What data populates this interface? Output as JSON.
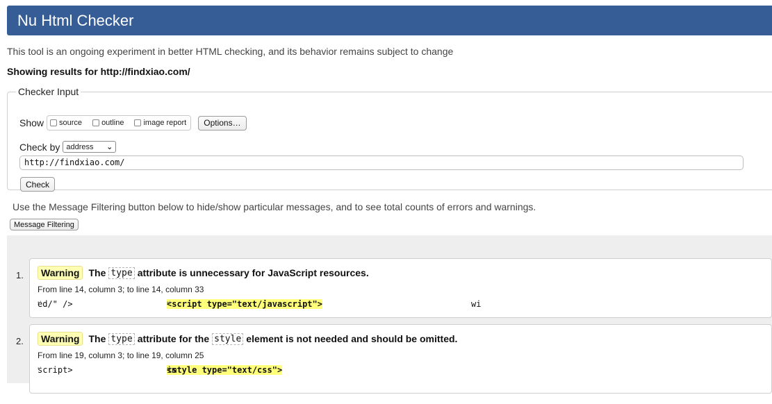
{
  "header": {
    "title": "Nu Html Checker"
  },
  "intro": "This tool is an ongoing experiment in better HTML checking, and its behavior remains subject to change",
  "showing": "Showing results for http://findxiao.com/",
  "checker": {
    "legend": "Checker Input",
    "show_label": "Show",
    "options": [
      {
        "label": "source",
        "checked": false
      },
      {
        "label": "outline",
        "checked": false
      },
      {
        "label": "image report",
        "checked": false
      }
    ],
    "options_button": "Options…",
    "check_by_label": "Check by",
    "check_by_value": "address",
    "url_value": "http://findxiao.com/",
    "check_button": "Check"
  },
  "filter": {
    "note": "Use the Message Filtering button below to hide/show particular messages, and to see total counts of errors and warnings.",
    "button": "Message Filtering"
  },
  "messages": [
    {
      "number": "1.",
      "badge": "Warning",
      "text_before": "The",
      "code1": "type",
      "text_after": "attribute is unnecessary for JavaScript resources.",
      "location": "From line 14, column 3; to line 14, column 33",
      "extract_before": "ed/\" />",
      "extract_highlight": "<script type=\"text/javascript\">",
      "extract_after": "wi"
    },
    {
      "number": "2.",
      "badge": "Warning",
      "text_before": "The",
      "code1": "type",
      "text_mid": "attribute for the",
      "code2": "style",
      "text_after": "element is not needed and should be omitted.",
      "location": "From line 19, column 3; to line 19, column 25",
      "extract_before": "script>",
      "extract_highlight": "<style type=\"text/css\">",
      "extract_after": "im"
    }
  ],
  "glyphs": {
    "return": "↩",
    "chevron": "⌄"
  }
}
